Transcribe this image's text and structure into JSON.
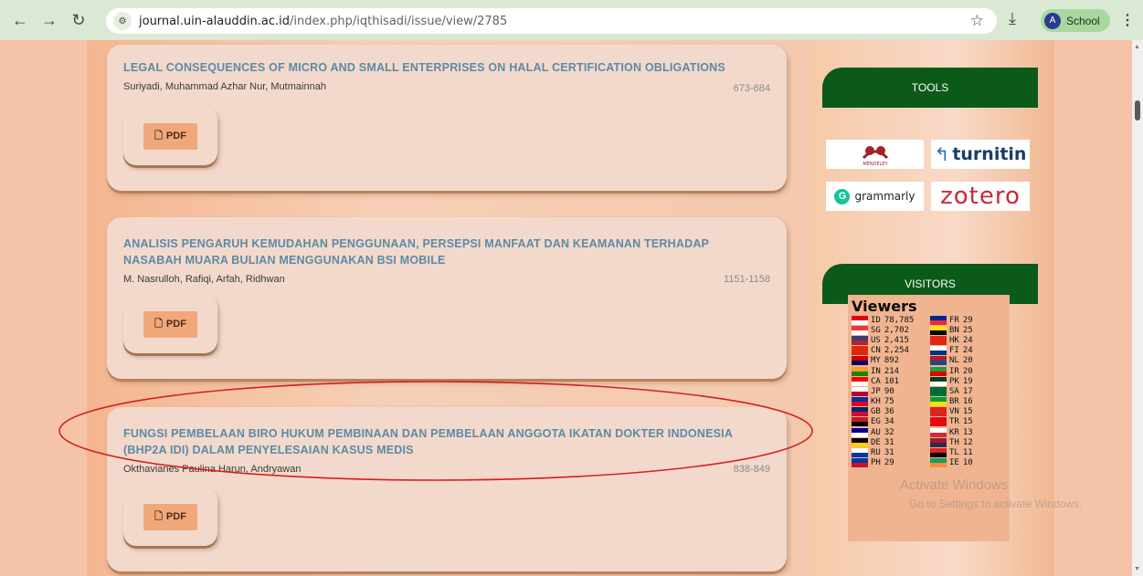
{
  "browser": {
    "url_host": "journal.uin-alauddin.ac.id",
    "url_path": "/index.php/iqthisadi/issue/view/2785",
    "profile_label": "School"
  },
  "articles": [
    {
      "title": "LEGAL CONSEQUENCES OF MICRO AND SMALL ENTERPRISES ON HALAL CERTIFICATION OBLIGATIONS",
      "authors": "Suriyadi, Muhammad Azhar Nur, Mutmainnah",
      "pages": "673-684",
      "pdf_label": "PDF"
    },
    {
      "title": "ANALISIS PENGARUH KEMUDAHAN PENGGUNAAN, PERSEPSI MANFAAT DAN KEAMANAN TERHADAP NASABAH MUARA BULIAN MENGGUNAKAN BSI MOBILE",
      "authors": "M. Nasrulloh, Rafiqi, Arfah, Ridhwan",
      "pages": "1151-1158",
      "pdf_label": "PDF"
    },
    {
      "title": "FUNGSI PEMBELAAN BIRO HUKUM PEMBINAAN DAN PEMBELAAN ANGGOTA IKATAN DOKTER INDONESIA (BHP2A IDI) DALAM PENYELESAIAN KASUS MEDIS",
      "authors": "Okthavianes Paulina Harun, Andryawan",
      "pages": "838-849",
      "pdf_label": "PDF"
    }
  ],
  "sidebar": {
    "tools_heading": "TOOLS",
    "tools": [
      "MENDELEY",
      "turnitin",
      "grammarly",
      "zotero"
    ],
    "visitors_heading": "VISITORS",
    "viewers_title": "Viewers",
    "flags_left": [
      {
        "code": "ID",
        "count": "78,785"
      },
      {
        "code": "SG",
        "count": "2,702"
      },
      {
        "code": "US",
        "count": "2,415"
      },
      {
        "code": "CN",
        "count": "2,254"
      },
      {
        "code": "MY",
        "count": "892"
      },
      {
        "code": "IN",
        "count": "214"
      },
      {
        "code": "CA",
        "count": "101"
      },
      {
        "code": "JP",
        "count": "90"
      },
      {
        "code": "KH",
        "count": "75"
      },
      {
        "code": "GB",
        "count": "36"
      },
      {
        "code": "EG",
        "count": "34"
      },
      {
        "code": "AU",
        "count": "32"
      },
      {
        "code": "DE",
        "count": "31"
      },
      {
        "code": "RU",
        "count": "31"
      },
      {
        "code": "PH",
        "count": "29"
      }
    ],
    "flags_right": [
      {
        "code": "FR",
        "count": "29"
      },
      {
        "code": "BN",
        "count": "25"
      },
      {
        "code": "HK",
        "count": "24"
      },
      {
        "code": "FI",
        "count": "24"
      },
      {
        "code": "NL",
        "count": "20"
      },
      {
        "code": "IR",
        "count": "20"
      },
      {
        "code": "PK",
        "count": "19"
      },
      {
        "code": "SA",
        "count": "17"
      },
      {
        "code": "BR",
        "count": "16"
      },
      {
        "code": "VN",
        "count": "15"
      },
      {
        "code": "TR",
        "count": "15"
      },
      {
        "code": "KR",
        "count": "13"
      },
      {
        "code": "TH",
        "count": "12"
      },
      {
        "code": "TL",
        "count": "11"
      },
      {
        "code": "IE",
        "count": "10"
      }
    ]
  },
  "watermark": {
    "line1": "Activate Windows",
    "line2": "Go to Settings to activate Windows."
  }
}
